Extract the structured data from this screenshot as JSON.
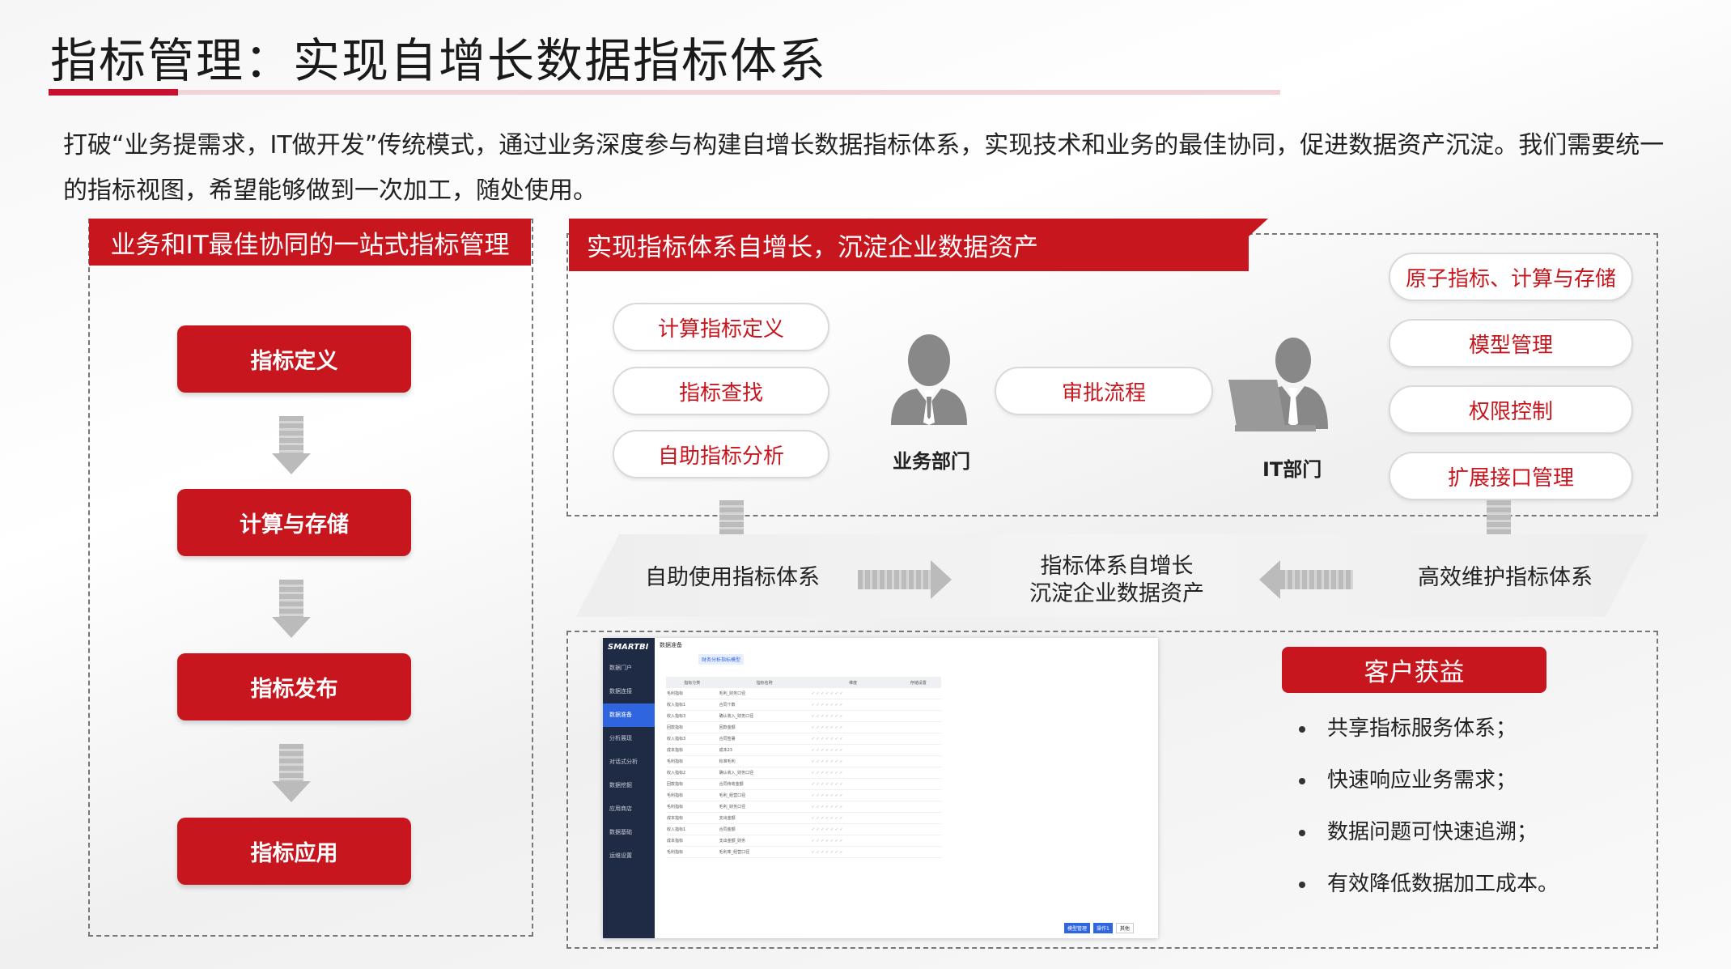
{
  "title": "指标管理：实现自增长数据指标体系",
  "intro": "打破“业务提需求，IT做开发”传统模式，通过业务深度参与构建自增长数据指标体系，实现技术和业务的最佳协同，促进数据资产沉淀。我们需要统一的指标视图，希望能够做到一次加工，随处使用。",
  "left_panel": {
    "header": "业务和IT最佳协同的一站式指标管理",
    "steps": [
      "指标定义",
      "计算与存储",
      "指标发布",
      "指标应用"
    ]
  },
  "top_panel": {
    "header": "实现指标体系自增长，沉淀企业数据资产",
    "business_pills": [
      "计算指标定义",
      "指标查找",
      "自助指标分析"
    ],
    "approval_pill": "审批流程",
    "business_label": "业务部门",
    "it_label": "IT部门",
    "it_pills": [
      "原子指标、计算与存储",
      "模型管理",
      "权限控制",
      "扩展接口管理"
    ]
  },
  "band": {
    "left": "自助使用指标体系",
    "center_line1": "指标体系自增长",
    "center_line2": "沉淀企业数据资产",
    "right": "高效维护指标体系"
  },
  "bottom_panel": {
    "benefit_header": "客户获益",
    "benefits": [
      "共享指标服务体系；",
      "快速响应业务需求；",
      "数据问题可快速追溯；",
      "有效降低数据加工成本。"
    ]
  },
  "screenshot": {
    "logo": "SMARTBI",
    "page_title": "数据准备",
    "tab": "财务分析指标模型",
    "nav": [
      "数据门户",
      "数据连接",
      "数据准备",
      "分析展现",
      "对话式分析",
      "数据挖掘",
      "应用商店",
      "数据基础",
      "运维设置"
    ],
    "columns": [
      "指标分类",
      "指标名称",
      "维度",
      "存储设置"
    ],
    "rows": [
      [
        "毛利指标",
        "毛利_财务口径"
      ],
      [
        "收入指标1",
        "合同个数"
      ],
      [
        "收入指标3",
        "确认收入_财务口径"
      ],
      [
        "回款指标",
        "回款金额"
      ],
      [
        "收入指标3",
        "合同签署"
      ],
      [
        "成本指标",
        "成本23"
      ],
      [
        "毛利指标",
        "标准毛利"
      ],
      [
        "收入指标2",
        "确认收入_财务口径"
      ],
      [
        "回款指标",
        "合同待收金额"
      ],
      [
        "毛利指标",
        "毛利_经营口径"
      ],
      [
        "毛利指标",
        "毛利_财务口径"
      ],
      [
        "成本指标",
        "支出金额"
      ],
      [
        "收入指标1",
        "合同金额"
      ],
      [
        "成本指标",
        "支出金额_财务"
      ],
      [
        "毛利指标",
        "毛利率_经营口径"
      ]
    ],
    "buttons": [
      "模型管理",
      "操作1",
      "其他"
    ]
  }
}
